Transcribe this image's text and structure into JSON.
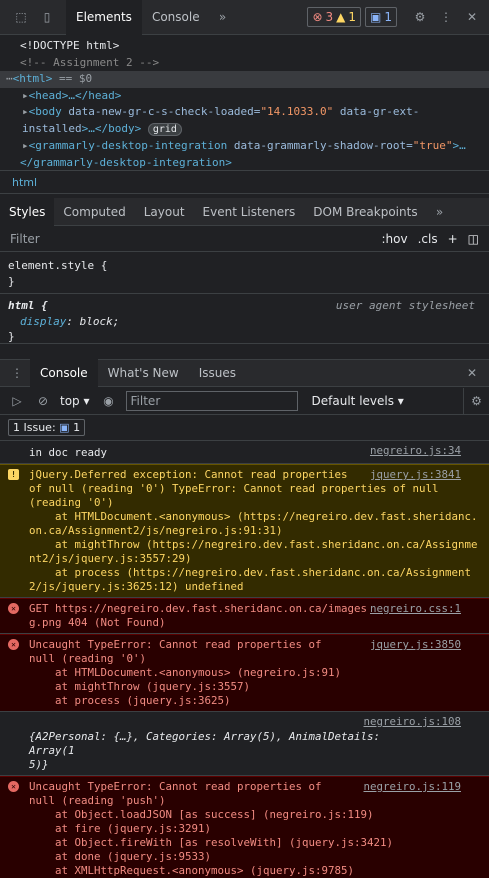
{
  "top_tabs": [
    "Elements",
    "Console"
  ],
  "badges": {
    "errors": "3",
    "warnings": "1",
    "issues": "1"
  },
  "elements": {
    "doctype": "<!DOCTYPE html>",
    "comment": "<!-- Assignment 2 -->",
    "html_line": "<html>",
    "html_eq": " == $0",
    "head": "<head>…</head>",
    "body_tag": "<body",
    "body_attr1": " data-new-gr-c-s-check-loaded=",
    "body_val1": "\"14.1033.0\"",
    "body_attr2": " data-gr-ext-",
    "body_attr2b": "installed",
    "body_close": ">…</body>",
    "grid_badge": "grid",
    "gram_tag": "<grammarly-desktop-integration",
    "gram_attr": " data-grammarly-shadow-root=",
    "gram_val": "\"true\"",
    "gram_more": ">…",
    "gram_close": "</grammarly-desktop-integration>"
  },
  "breadcrumb": "html",
  "style_tabs": [
    "Styles",
    "Computed",
    "Layout",
    "Event Listeners",
    "DOM Breakpoints"
  ],
  "filter": {
    "placeholder": "Filter",
    "hov": ":hov",
    "cls": ".cls"
  },
  "rules": {
    "element_style": "element.style {",
    "close": "}",
    "html_sel": "html {",
    "ua": "user agent stylesheet",
    "prop": "display",
    "value": "block;"
  },
  "console_tabs": [
    "Console",
    "What's New",
    "Issues"
  ],
  "console_tool": {
    "context": "top",
    "filter_placeholder": "Filter",
    "levels": "Default levels"
  },
  "issues_bar": {
    "label": "1 Issue:",
    "count": "1"
  },
  "messages": [
    {
      "type": "log",
      "text": "in doc ready",
      "src": "negreiro.js:34"
    },
    {
      "type": "warn",
      "src": "jquery.js:3841",
      "lines": [
        "jQuery.Deferred exception: Cannot read properties",
        "of null (reading '0') TypeError: Cannot read properties of null",
        "(reading '0')",
        "    at HTMLDocument.<anonymous> (https://negreiro.dev.fast.sheridanc.on.ca/Assignment2/js/negreiro.js:91:31)",
        "    at mightThrow (https://negreiro.dev.fast.sheridanc.on.ca/Assignment2/js/jquery.js:3557:29)",
        "    at process (https://negreiro.dev.fast.sheridanc.on.ca/Assignment2/js/jquery.js:3625:12) undefined"
      ]
    },
    {
      "type": "err",
      "src": "negreiro.css:1",
      "lines": [
        "GET https://negreiro.dev.fast.sheridanc.on.ca/images/bg.png 404 (Not Found)"
      ]
    },
    {
      "type": "err",
      "src": "jquery.js:3850",
      "lines": [
        "Uncaught TypeError: Cannot read properties of",
        "null (reading '0')",
        "    at HTMLDocument.<anonymous> (negreiro.js:91)",
        "    at mightThrow (jquery.js:3557)",
        "    at process (jquery.js:3625)"
      ]
    },
    {
      "type": "obj",
      "src": "negreiro.js:108",
      "lines": [
        "{A2Personal: {…}, Categories: Array(5), AnimalDetails: Array(1",
        "5)}"
      ]
    },
    {
      "type": "err",
      "src": "negreiro.js:119",
      "lines": [
        "Uncaught TypeError: Cannot read properties of",
        "null (reading 'push')",
        "    at Object.loadJSON [as success] (negreiro.js:119)",
        "    at fire (jquery.js:3291)",
        "    at Object.fireWith [as resolveWith] (jquery.js:3421)",
        "    at done (jquery.js:9533)",
        "    at XMLHttpRequest.<anonymous> (jquery.js:9785)"
      ]
    }
  ]
}
